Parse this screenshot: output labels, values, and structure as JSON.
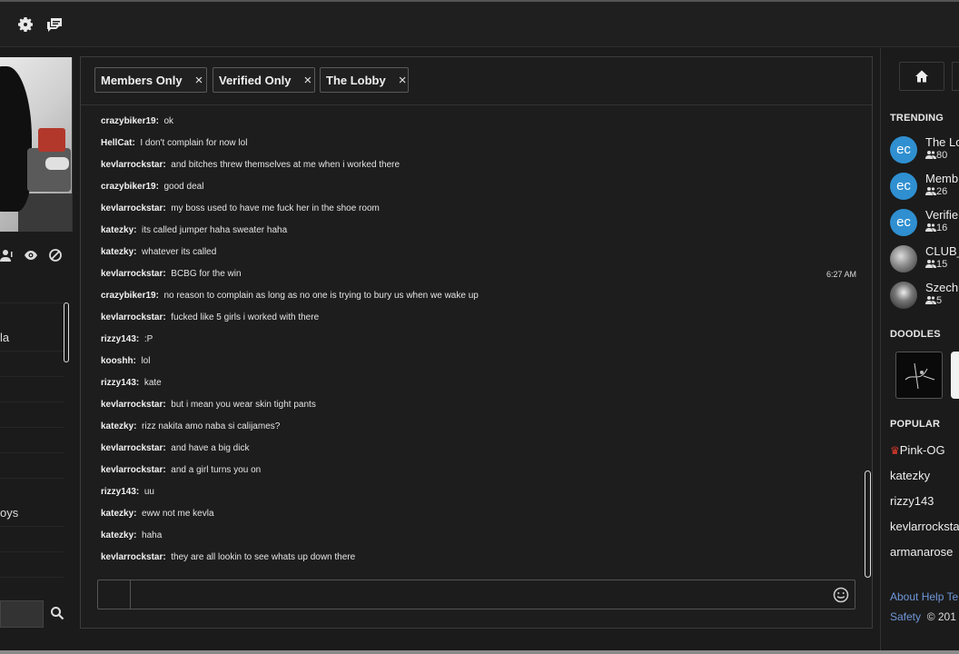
{
  "tabs": [
    {
      "label": "Members Only"
    },
    {
      "label": "Verified Only"
    },
    {
      "label": "The Lobby"
    }
  ],
  "close_glyph": "×",
  "left": {
    "users": [
      "",
      "la",
      "",
      "",
      "",
      "",
      "",
      "oys",
      "",
      "",
      ""
    ]
  },
  "messages": [
    {
      "user": "crazybiker19:",
      "text": "ok",
      "time": ""
    },
    {
      "user": "HellCat:",
      "text": "I don't complain for now lol",
      "time": ""
    },
    {
      "user": "kevlarrockstar:",
      "text": "and bitches threw themselves at me when i worked there",
      "time": ""
    },
    {
      "user": "crazybiker19:",
      "text": "good deal",
      "time": ""
    },
    {
      "user": "kevlarrockstar:",
      "text": "my boss used to have me fuck her in the shoe room",
      "time": ""
    },
    {
      "user": "katezky:",
      "text": "its called jumper haha sweater haha",
      "time": ""
    },
    {
      "user": "katezky:",
      "text": "whatever its called",
      "time": ""
    },
    {
      "user": "kevlarrockstar:",
      "text": "BCBG for the win",
      "time": "6:27 AM"
    },
    {
      "user": "crazybiker19:",
      "text": "no reason to complain as long as no one is trying to bury us when we wake up",
      "time": ""
    },
    {
      "user": "kevlarrockstar:",
      "text": "fucked like 5 girls i worked with there",
      "time": ""
    },
    {
      "user": "rizzy143:",
      "text": ":P",
      "time": ""
    },
    {
      "user": "kooshh:",
      "text": "lol",
      "time": ""
    },
    {
      "user": "rizzy143:",
      "text": "kate",
      "time": ""
    },
    {
      "user": "kevlarrockstar:",
      "text": "but i mean you wear skin tight pants",
      "time": ""
    },
    {
      "user": "katezky:",
      "text": "rizz nakita amo naba si calijames?",
      "time": ""
    },
    {
      "user": "kevlarrockstar:",
      "text": "and have a big dick",
      "time": ""
    },
    {
      "user": "kevlarrockstar:",
      "text": "and a girl turns you on",
      "time": ""
    },
    {
      "user": "rizzy143:",
      "text": "uu",
      "time": ""
    },
    {
      "user": "katezky:",
      "text": "eww not me kevla",
      "time": ""
    },
    {
      "user": "katezky:",
      "text": "haha",
      "time": ""
    },
    {
      "user": "kevlarrockstar:",
      "text": "they are all lookin to see whats up down there",
      "time": ""
    }
  ],
  "input": {
    "value": "",
    "placeholder": ""
  },
  "right": {
    "trending_title": "TRENDING",
    "trending": [
      {
        "name": "The Lo",
        "count": "80",
        "avatar": "ec"
      },
      {
        "name": "Memb",
        "count": "26",
        "avatar": "ec"
      },
      {
        "name": "Verifie",
        "count": "16",
        "avatar": "ec"
      },
      {
        "name": "CLUB_",
        "count": "15",
        "avatar": ""
      },
      {
        "name": "Szechu",
        "count": "5",
        "avatar": ""
      }
    ],
    "doodles_title": "DOODLES",
    "popular_title": "POPULAR",
    "popular": [
      "Pink-OG",
      "katezky",
      "rizzy143",
      "kevlarrocksta",
      "armanarose"
    ],
    "footer": {
      "about": "About",
      "help": "Help",
      "terms": "Te",
      "safety": "Safety",
      "copyright": "© 201"
    }
  },
  "colors": {
    "accent": "#2f8fd0",
    "link": "#6f97d8",
    "flame": "#e23b2b"
  }
}
